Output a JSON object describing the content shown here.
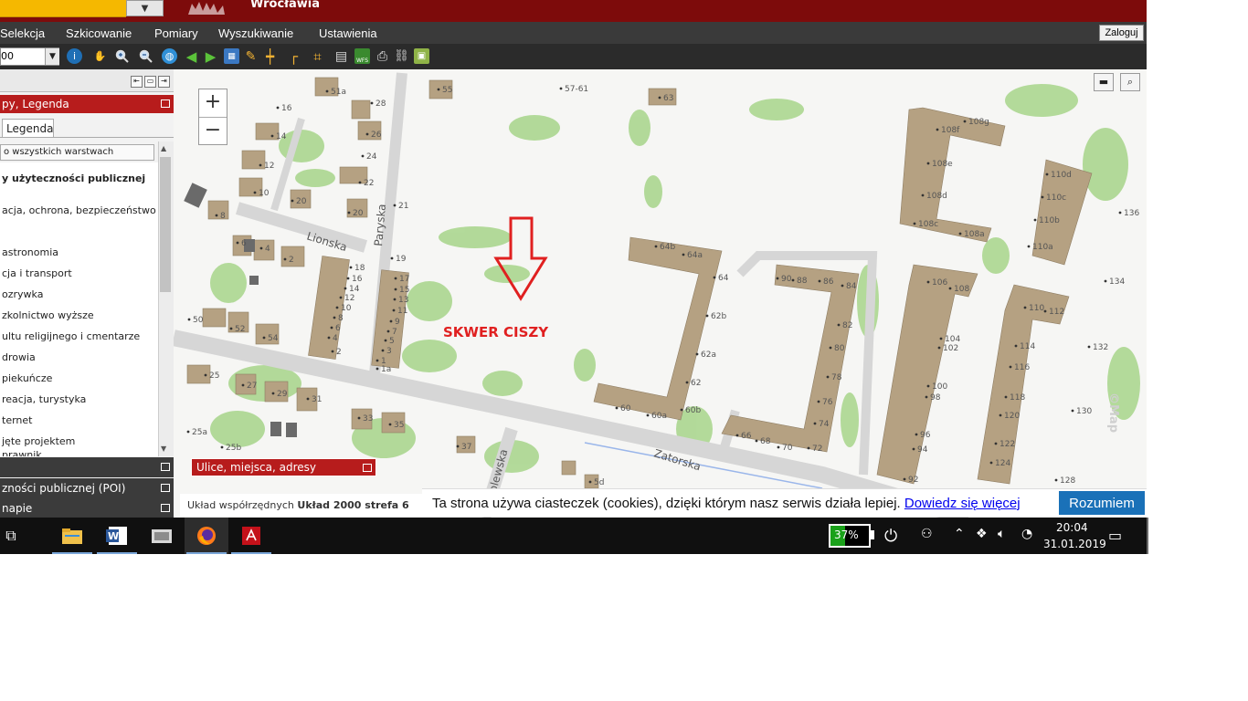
{
  "header": {
    "title": "Wrocławia",
    "dropdown_arrow": "▼"
  },
  "menu": {
    "items": [
      "Selekcja",
      "Szkicowanie",
      "Pomiary",
      "Wyszukiwanie",
      "Ustawienia"
    ],
    "login": "Zaloguj"
  },
  "toolbar": {
    "scale_value": "00",
    "tools": [
      "info-icon",
      "pan-hand-icon",
      "zoom-in-icon",
      "zoom-out-icon",
      "globe-icon",
      "back-arrow-icon",
      "forward-arrow-icon",
      "map-icon",
      "pencil-icon",
      "measure-line-icon",
      "measure-angle-icon",
      "crop-icon",
      "layers-icon",
      "wfs-icon",
      "print-icon",
      "link-icon",
      "export-icon"
    ],
    "wfs_label": "WFS"
  },
  "left_panel": {
    "legend_title": "py, Legenda",
    "tab_legend": "Legenda",
    "visibility_button": "o wszystkich warstwach",
    "layers": [
      {
        "label": "y użyteczności publicznej",
        "bold": true
      },
      {
        "label": "acja, ochrona, bezpieczeństwo",
        "bold": false
      },
      {
        "label": "astronomia",
        "bold": false
      },
      {
        "label": "cja i transport",
        "bold": false
      },
      {
        "label": "ozrywka",
        "bold": false
      },
      {
        "label": "zkolnictwo wyższe",
        "bold": false
      },
      {
        "label": "ultu religijnego i cmentarze",
        "bold": false
      },
      {
        "label": "drowia",
        "bold": false
      },
      {
        "label": "piekuńcze",
        "bold": false
      },
      {
        "label": "reacja, turystyka",
        "bold": false
      },
      {
        "label": "ternet",
        "bold": false
      },
      {
        "label": "jęte projektem",
        "bold": false
      },
      {
        "label": "prawnik",
        "bold": false
      }
    ],
    "section_poi": "zności publicznej (POI)",
    "section_maps": "napie"
  },
  "map": {
    "annotation": "SKWER CISZY",
    "zoom_in": "+",
    "zoom_out": "−",
    "search_bar": "Ulice, miejsca, adresy",
    "watermark": "©Map",
    "streets": [
      "Lionska",
      "Paryska",
      "Zatorska",
      "olewska"
    ],
    "house_numbers": [
      "51a",
      "55",
      "57-61",
      "63",
      "16",
      "28",
      "14",
      "26",
      "24",
      "12",
      "22",
      "10",
      "20",
      "20",
      "21",
      "8",
      "6",
      "4",
      "2",
      "19",
      "18",
      "16",
      "14",
      "12",
      "10",
      "8",
      "6",
      "4",
      "2",
      "17",
      "15",
      "13",
      "11",
      "9",
      "7",
      "5",
      "3",
      "1",
      "1a",
      "50",
      "52",
      "54",
      "25",
      "27",
      "29",
      "31",
      "33",
      "35",
      "25a",
      "25b",
      "37",
      "5d",
      "64b",
      "64a",
      "64",
      "62b",
      "62a",
      "62",
      "60",
      "60a",
      "60b",
      "90",
      "88",
      "86",
      "84",
      "82",
      "80",
      "78",
      "76",
      "74",
      "72",
      "70",
      "68",
      "66",
      "108f",
      "108g",
      "108e",
      "108d",
      "108c",
      "108a",
      "110d",
      "110c",
      "110b",
      "110a",
      "136",
      "106",
      "108",
      "104",
      "102",
      "100",
      "98",
      "96",
      "94",
      "92",
      "110",
      "112",
      "114",
      "116",
      "118",
      "120",
      "122",
      "124",
      "134",
      "132",
      "130",
      "128"
    ]
  },
  "status_bar": {
    "label": "Układ współrzędnych",
    "value": "Układ 2000 strefa 6"
  },
  "cookie_bar": {
    "text": "Ta strona używa ciasteczek (cookies), dzięki którym nasz serwis działa lepiej.",
    "link": "Dowiedz się więcej",
    "accept": "Rozumiem"
  },
  "taskbar": {
    "apps": [
      "task-view-icon",
      "file-explorer-icon",
      "word-icon",
      "photos-icon",
      "firefox-icon",
      "acrobat-icon"
    ],
    "battery_percent": 37,
    "battery_label": "37%",
    "time": "20:04",
    "date": "31.01.2019"
  },
  "colors": {
    "header_red": "#7d0b0b",
    "panel_red": "#b71c1c",
    "building": "#b5a182",
    "vegetation": "#a7d58a",
    "annotation_red": "#e02020",
    "cookie_blue": "#1a71b8"
  }
}
